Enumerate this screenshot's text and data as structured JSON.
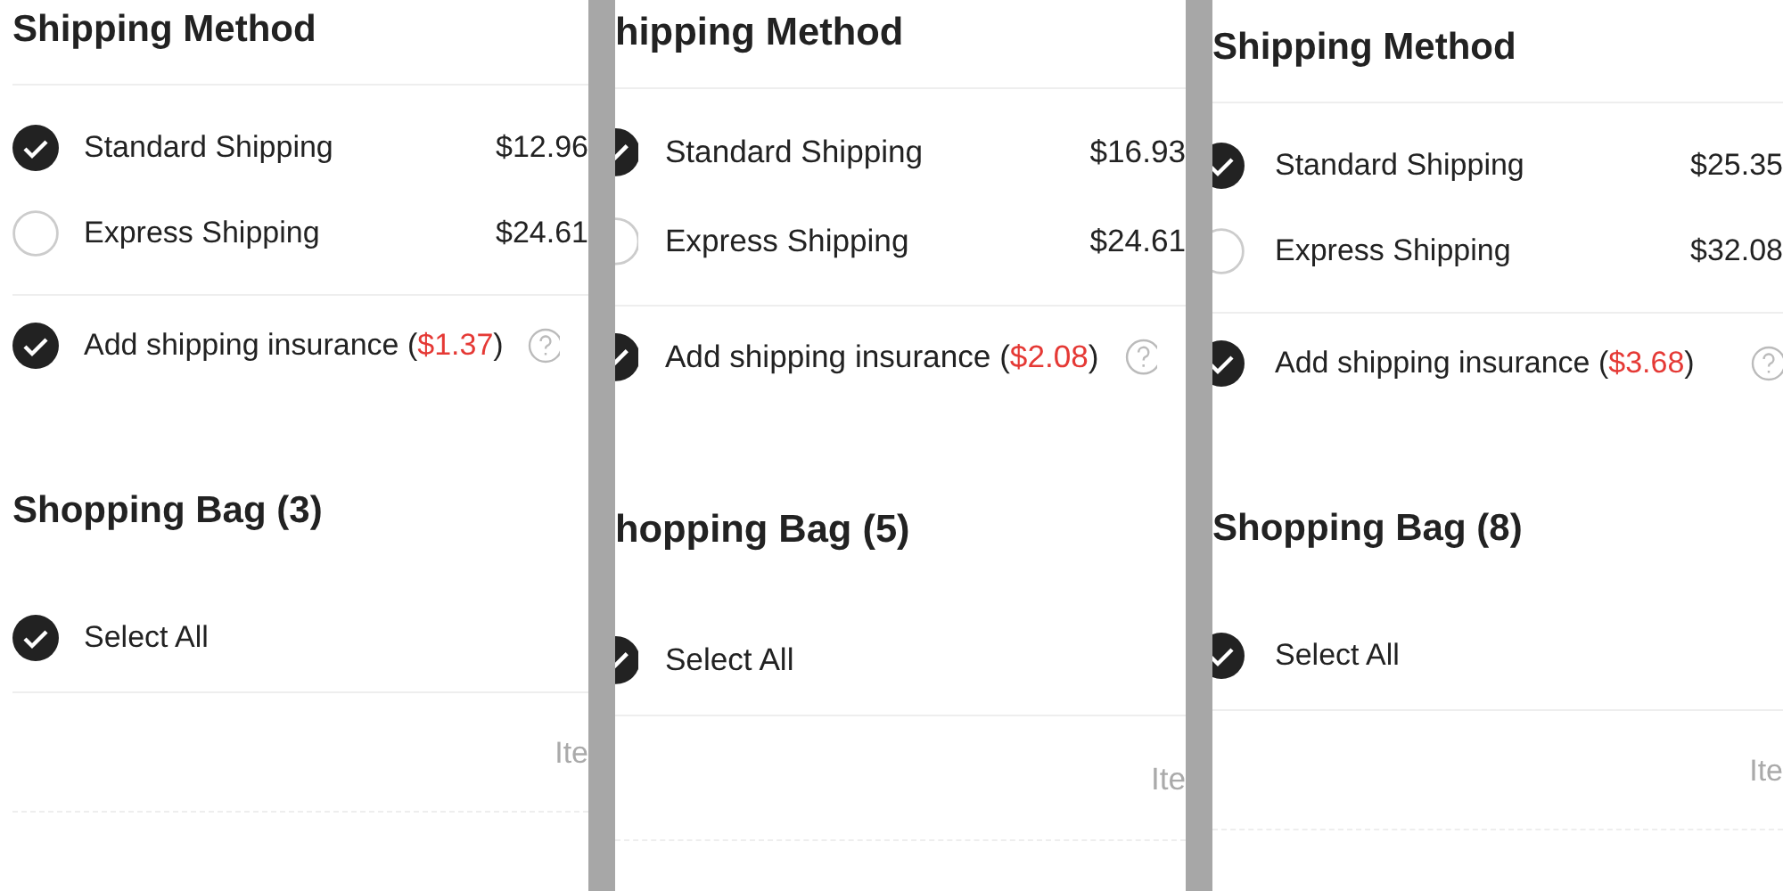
{
  "panels": [
    {
      "heading": "Shipping Method",
      "options": [
        {
          "label": "Standard Shipping",
          "price": "$12.96",
          "selected": true
        },
        {
          "label": "Express Shipping",
          "price": "$24.61",
          "selected": false
        }
      ],
      "insurance": {
        "label": "Add shipping insurance (",
        "price": "$1.37",
        "suffix": ")",
        "checked": true
      },
      "bag_heading": "Shopping Bag (3)",
      "select_all": {
        "label": "Select All",
        "checked": true
      },
      "column_1": "Ite"
    },
    {
      "heading": "hipping Method",
      "options": [
        {
          "label": "Standard Shipping",
          "price": "$16.93",
          "selected": true
        },
        {
          "label": "Express Shipping",
          "price": "$24.61",
          "selected": false
        }
      ],
      "insurance": {
        "label": "Add shipping insurance (",
        "price": "$2.08",
        "suffix": ")",
        "checked": true
      },
      "bag_heading": "hopping Bag (5)",
      "select_all": {
        "label": "Select All",
        "checked": true
      },
      "column_1": "Ite"
    },
    {
      "heading": "Shipping Method",
      "options": [
        {
          "label": "Standard Shipping",
          "price": "$25.35",
          "selected": true
        },
        {
          "label": "Express Shipping",
          "price": "$32.08",
          "selected": false
        }
      ],
      "insurance": {
        "label": "Add shipping insurance (",
        "price": "$3.68",
        "suffix": ")",
        "checked": true
      },
      "bag_heading": "Shopping Bag (8)",
      "select_all": {
        "label": "Select All",
        "checked": true
      },
      "column_1": "Ite"
    }
  ]
}
